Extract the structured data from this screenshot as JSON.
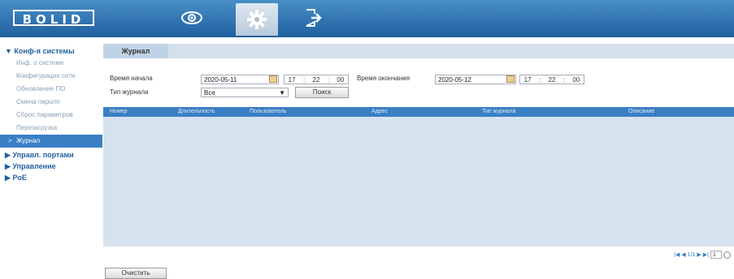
{
  "app": {
    "logo": "BOLID"
  },
  "nav": [
    {
      "name": "live",
      "icon": "eye-icon"
    },
    {
      "name": "settings",
      "icon": "gear-icon"
    },
    {
      "name": "logout",
      "icon": "exit-icon"
    }
  ],
  "sidebar": {
    "group1": "▼ Конф-я системы",
    "items": [
      {
        "label": "Инф. о системе"
      },
      {
        "label": "Конфигурация сети"
      },
      {
        "label": "Обновление ПО"
      },
      {
        "label": "Смена пароля"
      },
      {
        "label": "Сброс параметров"
      },
      {
        "label": "Перезагрузка"
      },
      {
        "label": "Журнал",
        "arrow": ">"
      }
    ],
    "group2": "▶ Управл. портами",
    "group3": "▶ Управление",
    "group4": "▶ PoE"
  },
  "main": {
    "tab": "Журнал",
    "start_label": "Время начала",
    "start_date": "2020-05-11",
    "start_time": {
      "h": "17",
      "m": "22",
      "s": "00"
    },
    "end_label": "Время окончания",
    "end_date": "2020-05-12",
    "end_time": {
      "h": "17",
      "m": "22",
      "s": "00"
    },
    "type_label": "Тип журнала",
    "type_value": "Все",
    "search_button": "Поиск",
    "columns": [
      "Номер",
      "Длительность",
      "Пользователь",
      "Адрес",
      "Тип журнала",
      "Описание"
    ],
    "pager": {
      "text": "1/1",
      "page": "1"
    },
    "clear_button": "Очистить"
  },
  "colors": {
    "topbar": "#1f5f9e",
    "accent": "#3a7fc4",
    "table_bg": "#d6e2ee"
  }
}
